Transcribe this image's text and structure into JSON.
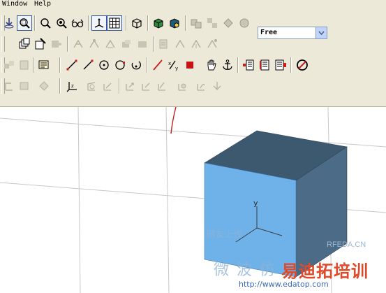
{
  "menubar": {
    "items": [
      "Window",
      "Help"
    ]
  },
  "toolbar": {
    "mode_select": {
      "value": "Free"
    }
  },
  "viewport": {
    "axis_label": "y",
    "watermarks": {
      "cn_small": "网友上传  ",
      "rfeda": "RFEDA.CN",
      "cn_big": "微  波  仿",
      "brand": "易迪拓培训",
      "url": "http://www.edatop.com"
    }
  },
  "colors": {
    "toolbar_bg": "#ece9d8",
    "cube_front": "#6fb2ea",
    "cube_top": "#3d5970",
    "cube_side": "#4c6b86",
    "highlight_red": "#cc1111",
    "annotation_red": "#c81e1e"
  }
}
